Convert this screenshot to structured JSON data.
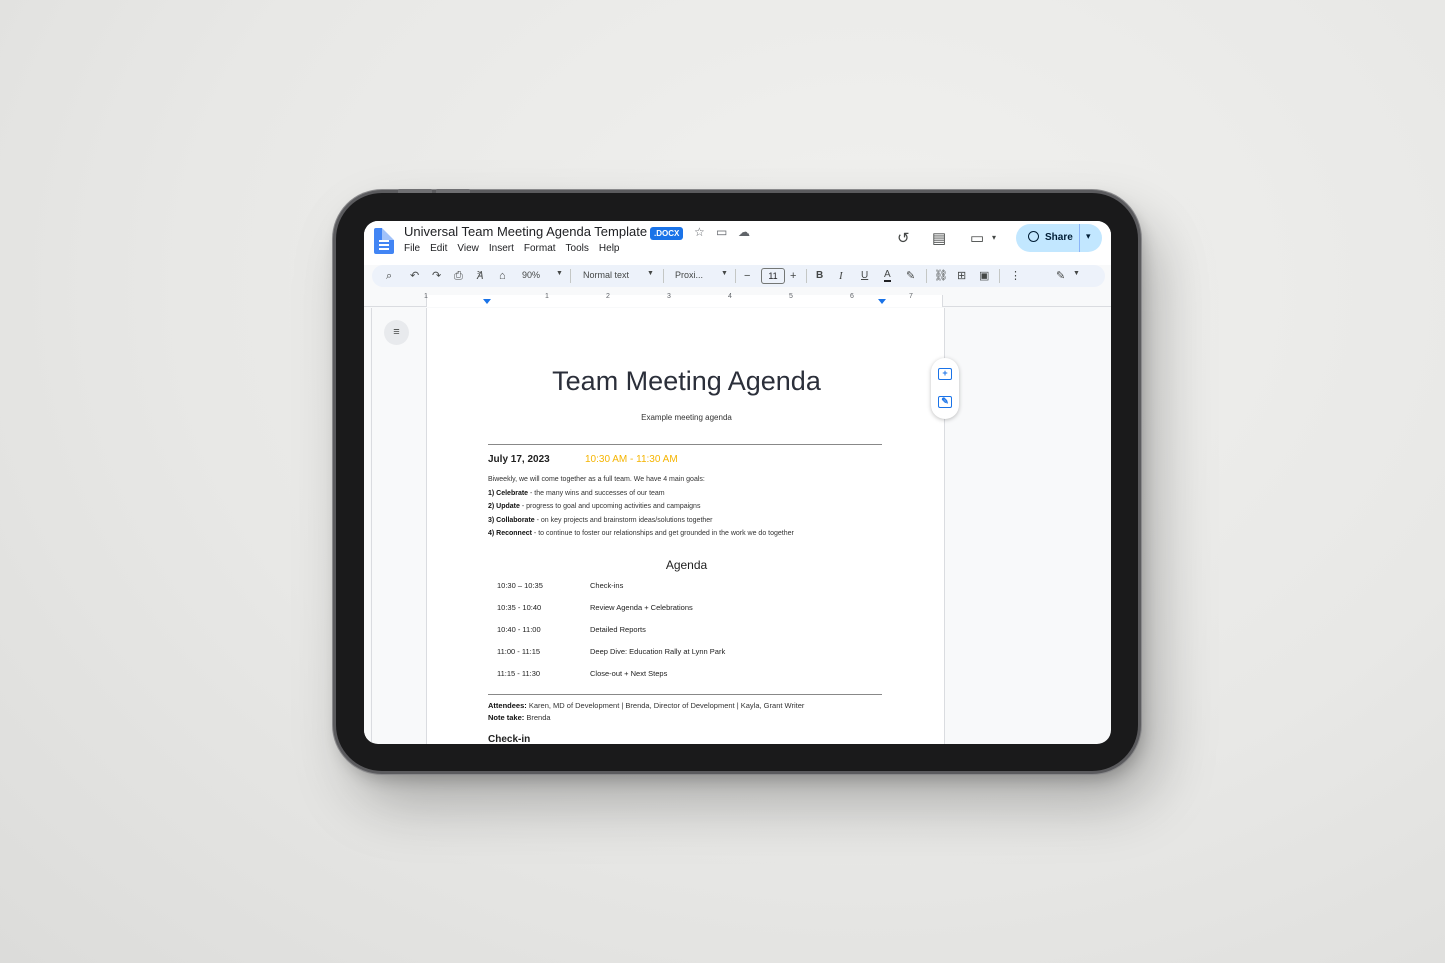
{
  "window": {
    "doc_title": "Universal Team Meeting Agenda Template",
    "badge": ".DOCX",
    "menu": [
      "File",
      "Edit",
      "View",
      "Insert",
      "Format",
      "Tools",
      "Help"
    ],
    "share_label": "Share"
  },
  "toolbar": {
    "zoom": "90%",
    "style": "Normal text",
    "font": "Proxi...",
    "font_size": "11",
    "bold": "B",
    "italic": "I",
    "underline": "U",
    "text_color": "A"
  },
  "ruler": {
    "numbers": [
      "1",
      "1",
      "2",
      "3",
      "4",
      "5",
      "6",
      "7"
    ]
  },
  "document": {
    "title": "Team Meeting Agenda",
    "subtitle": "Example meeting agenda",
    "date": "July 17, 2023",
    "time": "10:30 AM - 11:30 AM",
    "intro": "Biweekly, we will come together as a full team. We have 4 main goals:",
    "goals": [
      {
        "label": "1) Celebrate",
        "text": " - the many wins and successes of our team"
      },
      {
        "label": "2) Update",
        "text": " - progress to goal and upcoming activities and campaigns"
      },
      {
        "label": "3) Collaborate",
        "text": " - on key projects and brainstorm ideas/solutions together"
      },
      {
        "label": "4) Reconnect",
        "text": " - to continue to foster our relationships and get grounded in the work we do together"
      }
    ],
    "agenda_heading": "Agenda",
    "agenda": [
      {
        "time": "10:30 – 10:35",
        "item": "Check-ins"
      },
      {
        "time": "10:35 - 10:40",
        "item": "Review Agenda + Celebrations"
      },
      {
        "time": "10:40 - 11:00",
        "item": "Detailed Reports"
      },
      {
        "time": "11:00 - 11:15",
        "item": "Deep Dive: Education Rally at Lynn Park"
      },
      {
        "time": "11:15 - 11:30",
        "item": "Close-out + Next Steps"
      }
    ],
    "attendees_label": "Attendees:",
    "attendees": " Karen, MD of Development | Brenda, Director of Development | Kayla, Grant Writer",
    "notetaker_label": "Note take:",
    "notetaker": " Brenda",
    "next_heading": "Check-in"
  },
  "colors": {
    "accent": "#1a73e8",
    "time_highlight": "#f5b400",
    "share_bg": "#c2e7ff"
  }
}
